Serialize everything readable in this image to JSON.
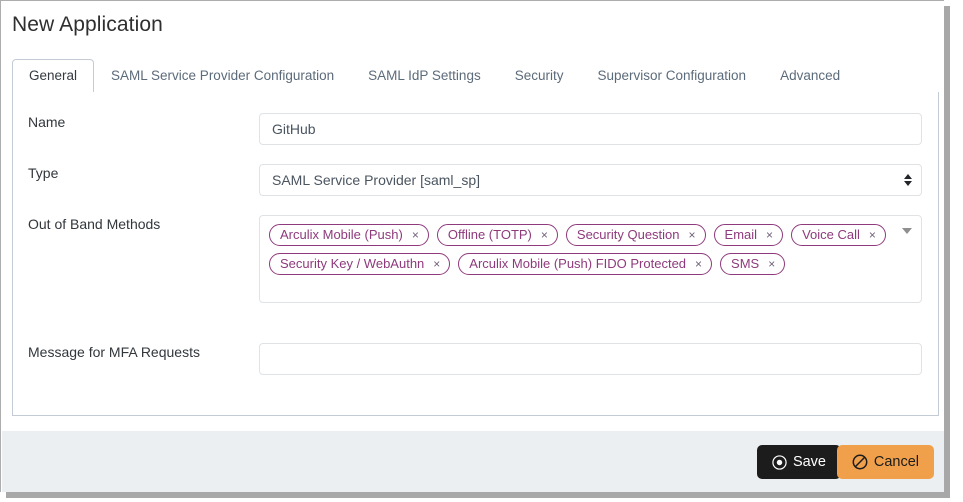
{
  "page": {
    "title": "New Application"
  },
  "tabs": [
    {
      "label": "General",
      "active": true
    },
    {
      "label": "SAML Service Provider Configuration",
      "active": false
    },
    {
      "label": "SAML IdP Settings",
      "active": false
    },
    {
      "label": "Security",
      "active": false
    },
    {
      "label": "Supervisor Configuration",
      "active": false
    },
    {
      "label": "Advanced",
      "active": false
    }
  ],
  "form": {
    "name": {
      "label": "Name",
      "value": "GitHub",
      "placeholder": ""
    },
    "type": {
      "label": "Type",
      "value": "SAML Service Provider [saml_sp]",
      "options": [
        "SAML Service Provider [saml_sp]"
      ]
    },
    "out_of_band_methods": {
      "label": "Out of Band Methods",
      "remove_glyph": "×",
      "dropdown_icon": "chevron-down-icon",
      "chips": [
        "Arculix Mobile (Push)",
        "Offline (TOTP)",
        "Security Question",
        "Email",
        "Voice Call",
        "Security Key / WebAuthn",
        "Arculix Mobile (Push) FIDO Protected",
        "SMS"
      ]
    },
    "mfa_message": {
      "label": "Message for MFA Requests",
      "value": "",
      "placeholder": ""
    }
  },
  "footer": {
    "save_label": "Save",
    "save_icon": "record-circle-icon",
    "cancel_label": "Cancel",
    "cancel_icon": "no-entry-icon"
  },
  "colors": {
    "chip_accent": "#8e3a7c",
    "save_bg": "#1c1c1c",
    "cancel_bg": "#f0a04b",
    "footer_bg": "#eceff1",
    "border": "#c3ccd4"
  }
}
